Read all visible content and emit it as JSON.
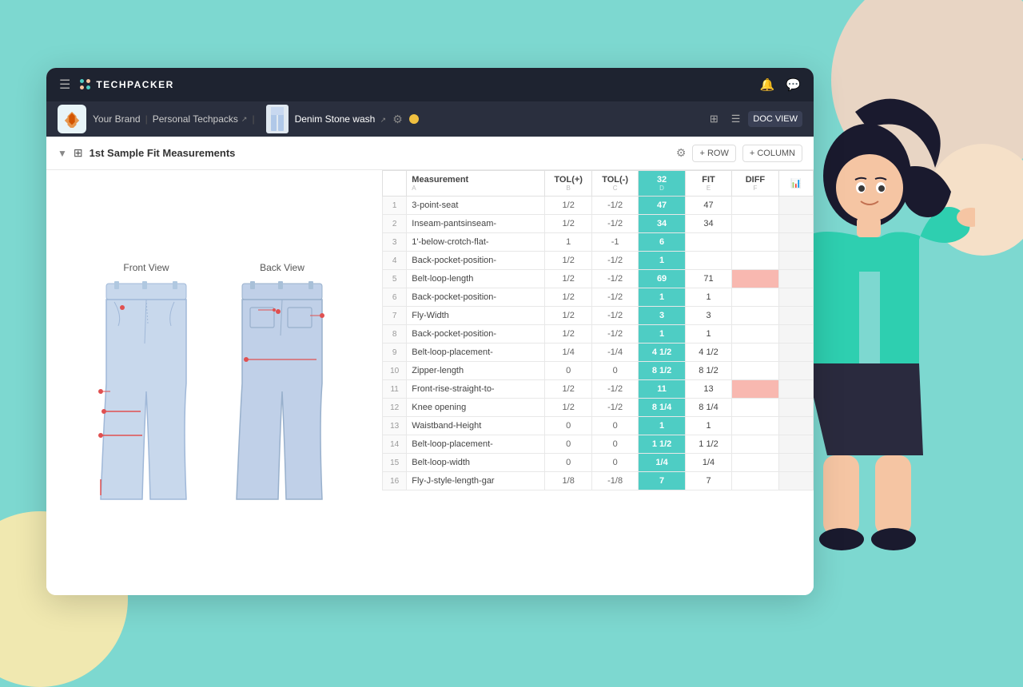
{
  "app": {
    "name": "TECHPACKER"
  },
  "breadcrumb": {
    "brand": "Your Brand",
    "techpacks": "Personal Techpacks",
    "product": "Denim Stone wash"
  },
  "section": {
    "title": "1st Sample Fit Measurements",
    "add_row": "+ ROW",
    "add_col": "+ COLUMN"
  },
  "views": {
    "grid": "⊞",
    "list": "☰",
    "doc": "DOC VIEW"
  },
  "table": {
    "columns": [
      {
        "label": "Measurement",
        "letter": "A"
      },
      {
        "label": "TOL(+)",
        "letter": "B"
      },
      {
        "label": "TOL(-)",
        "letter": "C"
      },
      {
        "label": "32",
        "letter": "D"
      },
      {
        "label": "FIT",
        "letter": "E"
      },
      {
        "label": "DIFF",
        "letter": "F"
      },
      {
        "label": "📊",
        "letter": ""
      }
    ],
    "rows": [
      {
        "num": 1,
        "measurement": "3-point-seat",
        "tol_plus": "1/2",
        "tol_minus": "-1/2",
        "size": "47",
        "fit": "47",
        "diff": "",
        "highlight": false
      },
      {
        "num": 2,
        "measurement": "Inseam-pantsinseam-",
        "tol_plus": "1/2",
        "tol_minus": "-1/2",
        "size": "34",
        "fit": "34",
        "diff": "",
        "highlight": false
      },
      {
        "num": 3,
        "measurement": "1'-below-crotch-flat-",
        "tol_plus": "1",
        "tol_minus": "-1",
        "size": "6",
        "fit": "",
        "diff": "",
        "highlight": false
      },
      {
        "num": 4,
        "measurement": "Back-pocket-position-",
        "tol_plus": "1/2",
        "tol_minus": "-1/2",
        "size": "1",
        "fit": "",
        "diff": "",
        "highlight": false
      },
      {
        "num": 5,
        "measurement": "Belt-loop-length",
        "tol_plus": "1/2",
        "tol_minus": "-1/2",
        "size": "69",
        "fit": "71",
        "diff": "",
        "highlight": true
      },
      {
        "num": 6,
        "measurement": "Back-pocket-position-",
        "tol_plus": "1/2",
        "tol_minus": "-1/2",
        "size": "1",
        "fit": "1",
        "diff": "",
        "highlight": false
      },
      {
        "num": 7,
        "measurement": "Fly-Width",
        "tol_plus": "1/2",
        "tol_minus": "-1/2",
        "size": "3",
        "fit": "3",
        "diff": "",
        "highlight": false
      },
      {
        "num": 8,
        "measurement": "Back-pocket-position-",
        "tol_plus": "1/2",
        "tol_minus": "-1/2",
        "size": "1",
        "fit": "1",
        "diff": "",
        "highlight": false
      },
      {
        "num": 9,
        "measurement": "Belt-loop-placement-",
        "tol_plus": "1/4",
        "tol_minus": "-1/4",
        "size": "4 1/2",
        "fit": "4 1/2",
        "diff": "",
        "highlight": false
      },
      {
        "num": 10,
        "measurement": "Zipper-length",
        "tol_plus": "0",
        "tol_minus": "0",
        "size": "8 1/2",
        "fit": "8 1/2",
        "diff": "",
        "highlight": false
      },
      {
        "num": 11,
        "measurement": "Front-rise-straight-to-",
        "tol_plus": "1/2",
        "tol_minus": "-1/2",
        "size": "11",
        "fit": "13",
        "diff": "",
        "highlight": true
      },
      {
        "num": 12,
        "measurement": "Knee opening",
        "tol_plus": "1/2",
        "tol_minus": "-1/2",
        "size": "8 1/4",
        "fit": "8 1/4",
        "diff": "",
        "highlight": false
      },
      {
        "num": 13,
        "measurement": "Waistband-Height",
        "tol_plus": "0",
        "tol_minus": "0",
        "size": "1",
        "fit": "1",
        "diff": "",
        "highlight": false
      },
      {
        "num": 14,
        "measurement": "Belt-loop-placement-",
        "tol_plus": "0",
        "tol_minus": "0",
        "size": "1 1/2",
        "fit": "1 1/2",
        "diff": "",
        "highlight": false
      },
      {
        "num": 15,
        "measurement": "Belt-loop-width",
        "tol_plus": "0",
        "tol_minus": "0",
        "size": "1/4",
        "fit": "1/4",
        "diff": "",
        "highlight": false
      },
      {
        "num": 16,
        "measurement": "Fly-J-style-length-gar",
        "tol_plus": "1/8",
        "tol_minus": "-1/8",
        "size": "7",
        "fit": "7",
        "diff": "",
        "highlight": false
      }
    ]
  },
  "garment": {
    "front_label": "Front View",
    "back_label": "Back View"
  }
}
